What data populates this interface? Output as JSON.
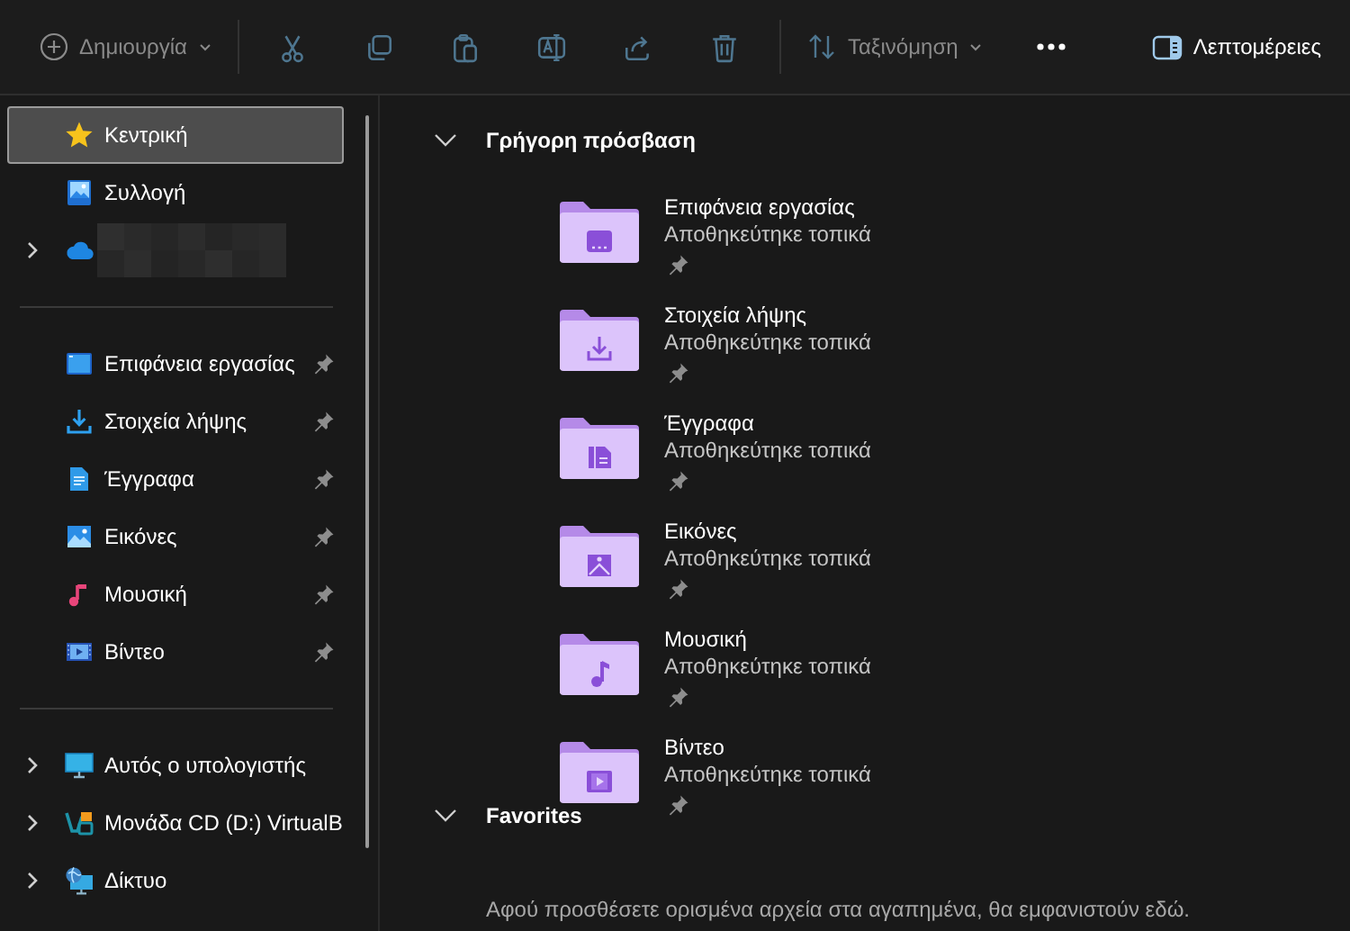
{
  "toolbar": {
    "new": {
      "label": "Δημιουργία",
      "disabled": true
    },
    "actions": [
      {
        "kind": "cut",
        "disabled": true
      },
      {
        "kind": "copy",
        "disabled": true
      },
      {
        "kind": "paste",
        "disabled": true
      },
      {
        "kind": "rename",
        "disabled": true
      },
      {
        "kind": "share",
        "disabled": true
      },
      {
        "kind": "delete",
        "disabled": true
      }
    ],
    "sort": {
      "label": "Ταξινόμηση",
      "disabled": true
    },
    "more": {
      "disabled": false
    },
    "details": {
      "label": "Λεπτομέρειες",
      "disabled": false
    }
  },
  "sidebar": {
    "groups": [
      [
        {
          "label": "Κεντρική",
          "kind": "home",
          "selected": true,
          "expandable": false,
          "pinned": false
        },
        {
          "label": "Συλλογή",
          "kind": "gallery",
          "selected": false,
          "expandable": false,
          "pinned": false
        },
        {
          "kind": "cloud",
          "selected": false,
          "expandable": true,
          "pinned": false,
          "redacted": true
        }
      ],
      [
        {
          "label": "Επιφάνεια εργασίας",
          "kind": "desktop",
          "selected": false,
          "expandable": false,
          "pinned": true
        },
        {
          "label": "Στοιχεία λήψης",
          "kind": "downloads",
          "selected": false,
          "expandable": false,
          "pinned": true
        },
        {
          "label": "Έγγραφα",
          "kind": "documents",
          "selected": false,
          "expandable": false,
          "pinned": true
        },
        {
          "label": "Εικόνες",
          "kind": "pictures",
          "selected": false,
          "expandable": false,
          "pinned": true
        },
        {
          "label": "Μουσική",
          "kind": "music",
          "selected": false,
          "expandable": false,
          "pinned": true
        },
        {
          "label": "Βίντεο",
          "kind": "videos",
          "selected": false,
          "expandable": false,
          "pinned": true
        }
      ],
      [
        {
          "label": "Αυτός ο υπολογιστής",
          "kind": "pc",
          "selected": false,
          "expandable": true,
          "pinned": false
        },
        {
          "label": "Μονάδα CD (D:) VirtualB",
          "kind": "cd",
          "selected": false,
          "expandable": true,
          "pinned": false
        },
        {
          "label": "Δίκτυο",
          "kind": "network",
          "selected": false,
          "expandable": true,
          "pinned": false
        }
      ]
    ]
  },
  "sections": [
    {
      "title": "Γρήγορη πρόσβαση",
      "expanded": true,
      "folders": [
        {
          "name": "Επιφάνεια εργασίας",
          "status": "Αποθηκεύτηκε τοπικά",
          "kind": "desktop",
          "pinned": true
        },
        {
          "name": "Στοιχεία λήψης",
          "status": "Αποθηκεύτηκε τοπικά",
          "kind": "downloads",
          "pinned": true
        },
        {
          "name": "Έγγραφα",
          "status": "Αποθηκεύτηκε τοπικά",
          "kind": "documents",
          "pinned": true
        },
        {
          "name": "Εικόνες",
          "status": "Αποθηκεύτηκε τοπικά",
          "kind": "pictures",
          "pinned": true
        },
        {
          "name": "Μουσική",
          "status": "Αποθηκεύτηκε τοπικά",
          "kind": "music",
          "pinned": true
        },
        {
          "name": "Βίντεο",
          "status": "Αποθηκεύτηκε τοπικά",
          "kind": "videos",
          "pinned": true
        }
      ]
    },
    {
      "title": "Favorites",
      "expanded": true,
      "message": "Αφού προσθέσετε ορισμένα αρχεία στα αγαπημένα, θα εμφανιστούν εδώ."
    }
  ]
}
